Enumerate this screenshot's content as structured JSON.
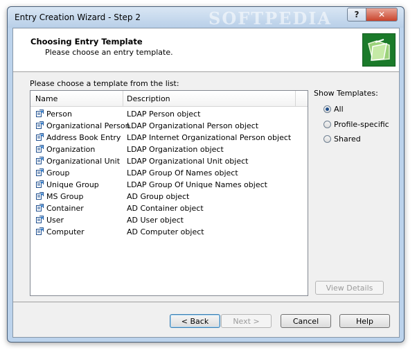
{
  "window": {
    "title": "Entry Creation Wizard - Step 2",
    "watermark": "SOFTPEDIA"
  },
  "titlebar_buttons": {
    "help": "?",
    "close": "✕"
  },
  "header": {
    "title": "Choosing Entry Template",
    "subtitle": "Please choose an entry template."
  },
  "list": {
    "label": "Please choose a template from the list:",
    "columns": [
      "Name",
      "Description"
    ],
    "rows": [
      {
        "name": "Person",
        "description": "LDAP Person object"
      },
      {
        "name": "Organizational Person",
        "description": "LDAP Organizational Person object"
      },
      {
        "name": "Address Book Entry",
        "description": "LDAP Internet Organizational Person object"
      },
      {
        "name": "Organization",
        "description": "LDAP Organization object"
      },
      {
        "name": "Organizational Unit",
        "description": "LDAP Organizational Unit object"
      },
      {
        "name": "Group",
        "description": "LDAP Group Of Names object"
      },
      {
        "name": "Unique Group",
        "description": "LDAP Group Of Unique Names object"
      },
      {
        "name": "MS Group",
        "description": "AD Group object"
      },
      {
        "name": "Container",
        "description": "AD Container object"
      },
      {
        "name": "User",
        "description": "AD User object"
      },
      {
        "name": "Computer",
        "description": "AD Computer object"
      }
    ]
  },
  "show_templates": {
    "label": "Show Templates:",
    "options": [
      {
        "label": "All",
        "selected": true
      },
      {
        "label": "Profile-specific",
        "selected": false
      },
      {
        "label": "Shared",
        "selected": false
      }
    ]
  },
  "buttons": {
    "view_details": "View Details",
    "back": "< Back",
    "next": "Next >",
    "cancel": "Cancel",
    "help": "Help"
  },
  "icons": {
    "row_icon": "template-entry-icon",
    "wizard_icon": "open-folder-icon"
  },
  "colors": {
    "wizard_icon_bg": "#1b7a2a",
    "title_bar": "#bcd3ec",
    "close_button": "#c9442c"
  }
}
